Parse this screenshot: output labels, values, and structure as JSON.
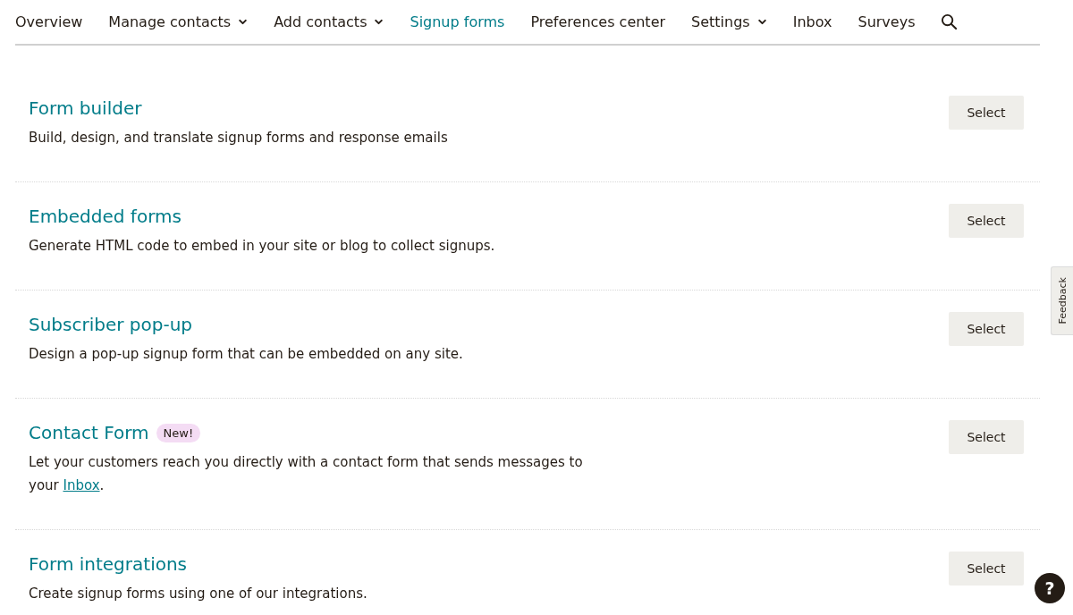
{
  "nav": {
    "items": [
      {
        "label": "Overview",
        "dropdown": false,
        "selected": false
      },
      {
        "label": "Manage contacts",
        "dropdown": true,
        "selected": false
      },
      {
        "label": "Add contacts",
        "dropdown": true,
        "selected": false
      },
      {
        "label": "Signup forms",
        "dropdown": false,
        "selected": true
      },
      {
        "label": "Preferences center",
        "dropdown": false,
        "selected": false
      },
      {
        "label": "Settings",
        "dropdown": true,
        "selected": false
      },
      {
        "label": "Inbox",
        "dropdown": false,
        "selected": false
      },
      {
        "label": "Surveys",
        "dropdown": false,
        "selected": false
      }
    ]
  },
  "options": [
    {
      "title": "Form builder",
      "description": "Build, design, and translate signup forms and response emails",
      "button": "Select"
    },
    {
      "title": "Embedded forms",
      "description": "Generate HTML code to embed in your site or blog to collect signups.",
      "button": "Select"
    },
    {
      "title": "Subscriber pop-up",
      "description": "Design a pop-up signup form that can be embedded on any site.",
      "button": "Select"
    },
    {
      "title": "Contact Form",
      "badge": "New!",
      "description": "Let your customers reach you directly with a contact form that sends messages to your ",
      "link": "Inbox",
      "description_end": ".",
      "button": "Select"
    },
    {
      "title": "Form integrations",
      "description": "Create signup forms using one of our integrations.",
      "button": "Select"
    }
  ],
  "feedback_tab": "Feedback",
  "help_button": "?"
}
